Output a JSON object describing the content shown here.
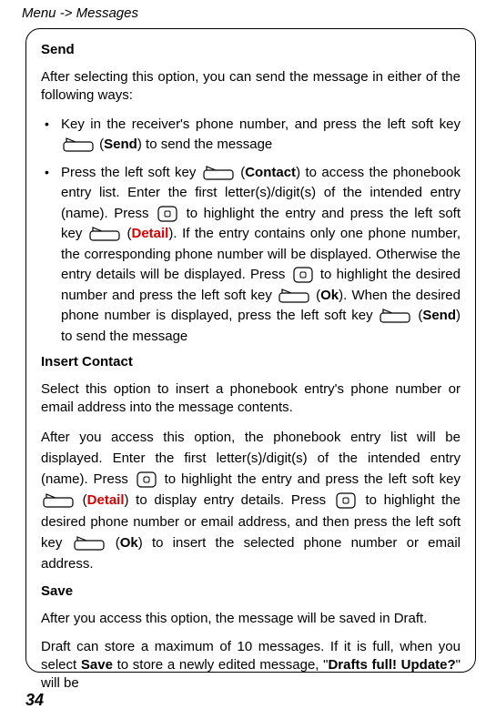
{
  "breadcrumb": "Menu -> Messages",
  "sections": {
    "send": {
      "title": "Send",
      "intro": "After selecting this option, you can send the message in either of the following ways:",
      "bullets": [
        {
          "pre1": "Key in the receiver's phone number, and press the left soft key ",
          "post1_open": " (",
          "ok1": "Send",
          "post1_close": ") to send the message"
        },
        {
          "p1a": "Press the left soft key ",
          "p1b_open": " (",
          "p1b_label": "Contact",
          "p1b_close": ") to access the phonebook entry list. Enter the first letter(s)/digit(s) of the intended entry (name). Press ",
          "p1c": " to highlight the entry and press the left soft key ",
          "p1c_open": " (",
          "p1c_label": "Detail",
          "p1c_close": "). If the entry contains only one phone number, the corresponding phone number will be displayed. Otherwise the entry details will be displayed. Press ",
          "p1d": " to highlight the desired number and press the left soft key ",
          "p1d_open": " (",
          "p1d_label": "Ok",
          "p1d_close": "). When the desired phone number is displayed, press the left soft key ",
          "p1e_open": " (",
          "p1e_label": "Send",
          "p1e_close": ") to send the message"
        }
      ]
    },
    "insert": {
      "title": "Insert Contact",
      "p1": "Select this option to insert a phonebook entry's phone number or email address into the message contents.",
      "p2a": "After you access this option, the phonebook entry list will be displayed. Enter the first letter(s)/digit(s) of the intended entry (name). Press ",
      "p2b": " to highlight the entry and press the left soft key ",
      "p2b_open": " (",
      "p2b_label": "Detail",
      "p2b_close": ") to display entry details. Press ",
      "p2c": " to highlight the desired phone number or email address, and then press the left soft key ",
      "p2c_open": " (",
      "p2c_label": "Ok",
      "p2c_close": ") to insert the selected phone number or email address."
    },
    "save": {
      "title": "Save",
      "p1": "After you access this option, the message will be saved in Draft.",
      "p2a": "Draft can store a maximum of 10 messages. If it is full, when you select ",
      "p2a_b": "Save",
      "p2b": " to store a newly edited message, \"",
      "p2b_q": "Drafts full! Update?",
      "p2c": "\" will be"
    }
  },
  "pagenum": "34"
}
